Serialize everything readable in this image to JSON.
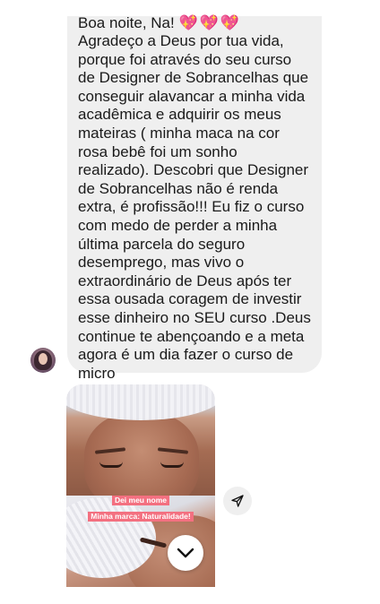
{
  "message": {
    "greeting": "Boa noite, Na!",
    "greeting_emoji": "💖💖💖",
    "body": "Agradeço a Deus por tua vida, porque foi através do seu curso de Designer de Sobrancelhas que conseguir alavancar a minha vida acadêmica e adquirir os meus mateiras ( minha maca na cor rosa bebê foi um sonho realizado). Descobri que Designer de Sobrancelhas não é renda extra, é profissão!!! Eu fiz o curso com medo de perder a minha última parcela do seguro desemprego, mas vivo o extraordinário de Deus após ter essa ousada coragem de investir esse dinheiro no SEU curso .Deus continue te abençoando e a meta agora é um dia fazer o curso de micro"
  },
  "media": {
    "caption_line1": "Dei meu nome",
    "caption_line2": "Minha marca: Naturalidade!"
  },
  "icons": {
    "share": "paper-plane-icon",
    "scroll": "chevron-down-icon"
  },
  "colors": {
    "bubble": "#efefef",
    "caption_bg": "#f37080"
  }
}
